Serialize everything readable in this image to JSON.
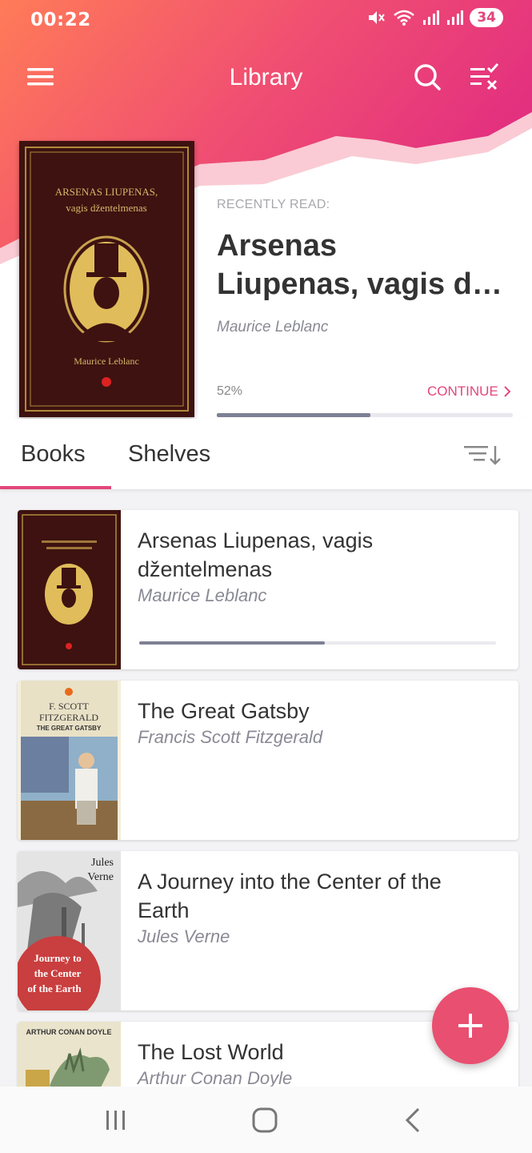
{
  "status_bar": {
    "time": "00:22",
    "battery": "34"
  },
  "toolbar": {
    "title": "Library",
    "menu_icon": "hamburger-menu-icon",
    "search_icon": "search-icon",
    "select_icon": "checklist-icon"
  },
  "recent": {
    "label": "RECENTLY READ:",
    "title_line1": "Arsenas",
    "title_line2": "Liupenas, vagis d…",
    "author": "Maurice Leblanc",
    "percent": "52%",
    "progress": 0.52,
    "continue_label": "CONTINUE",
    "cover": {
      "title_line1": "ARSENAS LIUPENAS,",
      "title_line2": "vagis džentelmenas",
      "author": "Maurice Leblanc"
    }
  },
  "tabs": {
    "books": "Books",
    "shelves": "Shelves",
    "sort_icon": "sort-icon"
  },
  "books": [
    {
      "title": "Arsenas Liupenas, vagis džentelmenas",
      "author": "Maurice Leblanc",
      "progress": 0.52
    },
    {
      "title": "The Great Gatsby",
      "author": "Francis Scott Fitzgerald",
      "cover_author_line1": "F. SCOTT",
      "cover_author_line2": "FITZGERALD",
      "cover_title": "THE GREAT GATSBY"
    },
    {
      "title": "A Journey into the Center of the Earth",
      "author": "Jules Verne",
      "cover_author_line1": "Jules",
      "cover_author_line2": "Verne",
      "cover_title_line1": "Journey to",
      "cover_title_line2": "the Center",
      "cover_title_line3": "of the Earth"
    },
    {
      "title": "The Lost World",
      "author": "Arthur Conan Doyle",
      "cover_author": "ARTHUR CONAN DOYLE"
    }
  ],
  "colors": {
    "accent": "#e2477a",
    "header_gradient_start": "#ff7a5a",
    "header_gradient_end": "#e5347c"
  }
}
